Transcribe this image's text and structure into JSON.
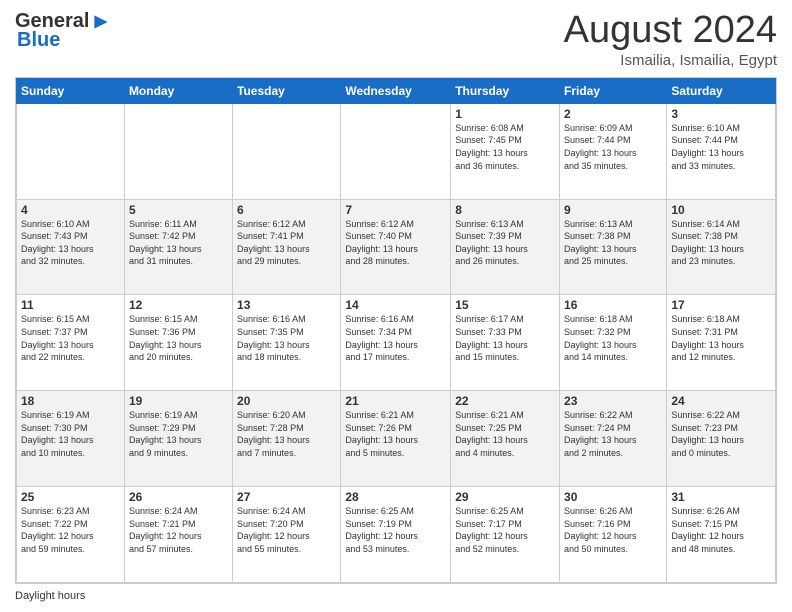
{
  "header": {
    "logo_general": "General",
    "logo_blue": "Blue",
    "month_title": "August 2024",
    "location": "Ismailia, Ismailia, Egypt"
  },
  "weekdays": [
    "Sunday",
    "Monday",
    "Tuesday",
    "Wednesday",
    "Thursday",
    "Friday",
    "Saturday"
  ],
  "weeks": [
    [
      {
        "day": "",
        "info": ""
      },
      {
        "day": "",
        "info": ""
      },
      {
        "day": "",
        "info": ""
      },
      {
        "day": "",
        "info": ""
      },
      {
        "day": "1",
        "info": "Sunrise: 6:08 AM\nSunset: 7:45 PM\nDaylight: 13 hours\nand 36 minutes."
      },
      {
        "day": "2",
        "info": "Sunrise: 6:09 AM\nSunset: 7:44 PM\nDaylight: 13 hours\nand 35 minutes."
      },
      {
        "day": "3",
        "info": "Sunrise: 6:10 AM\nSunset: 7:44 PM\nDaylight: 13 hours\nand 33 minutes."
      }
    ],
    [
      {
        "day": "4",
        "info": "Sunrise: 6:10 AM\nSunset: 7:43 PM\nDaylight: 13 hours\nand 32 minutes."
      },
      {
        "day": "5",
        "info": "Sunrise: 6:11 AM\nSunset: 7:42 PM\nDaylight: 13 hours\nand 31 minutes."
      },
      {
        "day": "6",
        "info": "Sunrise: 6:12 AM\nSunset: 7:41 PM\nDaylight: 13 hours\nand 29 minutes."
      },
      {
        "day": "7",
        "info": "Sunrise: 6:12 AM\nSunset: 7:40 PM\nDaylight: 13 hours\nand 28 minutes."
      },
      {
        "day": "8",
        "info": "Sunrise: 6:13 AM\nSunset: 7:39 PM\nDaylight: 13 hours\nand 26 minutes."
      },
      {
        "day": "9",
        "info": "Sunrise: 6:13 AM\nSunset: 7:38 PM\nDaylight: 13 hours\nand 25 minutes."
      },
      {
        "day": "10",
        "info": "Sunrise: 6:14 AM\nSunset: 7:38 PM\nDaylight: 13 hours\nand 23 minutes."
      }
    ],
    [
      {
        "day": "11",
        "info": "Sunrise: 6:15 AM\nSunset: 7:37 PM\nDaylight: 13 hours\nand 22 minutes."
      },
      {
        "day": "12",
        "info": "Sunrise: 6:15 AM\nSunset: 7:36 PM\nDaylight: 13 hours\nand 20 minutes."
      },
      {
        "day": "13",
        "info": "Sunrise: 6:16 AM\nSunset: 7:35 PM\nDaylight: 13 hours\nand 18 minutes."
      },
      {
        "day": "14",
        "info": "Sunrise: 6:16 AM\nSunset: 7:34 PM\nDaylight: 13 hours\nand 17 minutes."
      },
      {
        "day": "15",
        "info": "Sunrise: 6:17 AM\nSunset: 7:33 PM\nDaylight: 13 hours\nand 15 minutes."
      },
      {
        "day": "16",
        "info": "Sunrise: 6:18 AM\nSunset: 7:32 PM\nDaylight: 13 hours\nand 14 minutes."
      },
      {
        "day": "17",
        "info": "Sunrise: 6:18 AM\nSunset: 7:31 PM\nDaylight: 13 hours\nand 12 minutes."
      }
    ],
    [
      {
        "day": "18",
        "info": "Sunrise: 6:19 AM\nSunset: 7:30 PM\nDaylight: 13 hours\nand 10 minutes."
      },
      {
        "day": "19",
        "info": "Sunrise: 6:19 AM\nSunset: 7:29 PM\nDaylight: 13 hours\nand 9 minutes."
      },
      {
        "day": "20",
        "info": "Sunrise: 6:20 AM\nSunset: 7:28 PM\nDaylight: 13 hours\nand 7 minutes."
      },
      {
        "day": "21",
        "info": "Sunrise: 6:21 AM\nSunset: 7:26 PM\nDaylight: 13 hours\nand 5 minutes."
      },
      {
        "day": "22",
        "info": "Sunrise: 6:21 AM\nSunset: 7:25 PM\nDaylight: 13 hours\nand 4 minutes."
      },
      {
        "day": "23",
        "info": "Sunrise: 6:22 AM\nSunset: 7:24 PM\nDaylight: 13 hours\nand 2 minutes."
      },
      {
        "day": "24",
        "info": "Sunrise: 6:22 AM\nSunset: 7:23 PM\nDaylight: 13 hours\nand 0 minutes."
      }
    ],
    [
      {
        "day": "25",
        "info": "Sunrise: 6:23 AM\nSunset: 7:22 PM\nDaylight: 12 hours\nand 59 minutes."
      },
      {
        "day": "26",
        "info": "Sunrise: 6:24 AM\nSunset: 7:21 PM\nDaylight: 12 hours\nand 57 minutes."
      },
      {
        "day": "27",
        "info": "Sunrise: 6:24 AM\nSunset: 7:20 PM\nDaylight: 12 hours\nand 55 minutes."
      },
      {
        "day": "28",
        "info": "Sunrise: 6:25 AM\nSunset: 7:19 PM\nDaylight: 12 hours\nand 53 minutes."
      },
      {
        "day": "29",
        "info": "Sunrise: 6:25 AM\nSunset: 7:17 PM\nDaylight: 12 hours\nand 52 minutes."
      },
      {
        "day": "30",
        "info": "Sunrise: 6:26 AM\nSunset: 7:16 PM\nDaylight: 12 hours\nand 50 minutes."
      },
      {
        "day": "31",
        "info": "Sunrise: 6:26 AM\nSunset: 7:15 PM\nDaylight: 12 hours\nand 48 minutes."
      }
    ]
  ],
  "footer": {
    "daylight_label": "Daylight hours"
  }
}
